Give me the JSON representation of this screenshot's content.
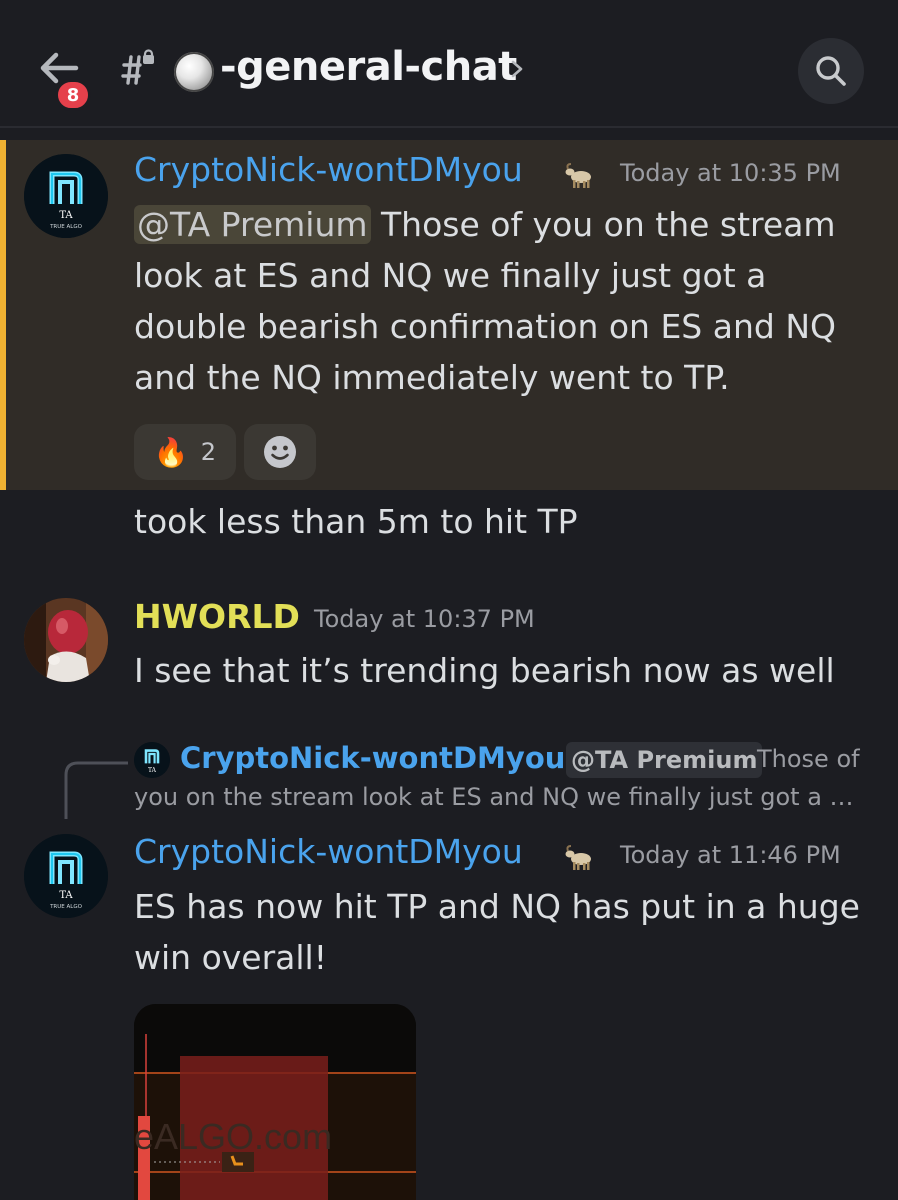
{
  "header": {
    "unread_badge": "8",
    "channel_name": "-general-chat",
    "back_icon": "arrow-left-icon",
    "hash_icon": "hash-icon",
    "search_icon": "search-icon"
  },
  "messages": [
    {
      "username": "CryptoNick-wontDMyou",
      "role_icon": "goat-icon",
      "timestamp": "Today at 10:35 PM",
      "mention": "@TA Premium",
      "lines_after_mention": " Those of you on the stream",
      "lines": [
        "look at ES and NQ we finally just got a",
        "double bearish confirmation on ES and NQ",
        "and the NQ immediately went to TP."
      ],
      "reactions": [
        {
          "emoji": "🔥",
          "count": "2"
        }
      ],
      "add_reaction_icon": "smiley-icon"
    },
    {
      "text": "took less than 5m to hit TP"
    },
    {
      "username": "HWORLD",
      "timestamp": "Today at 10:37 PM",
      "text": "I see that it’s trending bearish now as well"
    },
    {
      "reply": {
        "username": "CryptoNick-wontDMyou",
        "mention": "@TA Premium",
        "text_line1": "Those of",
        "text_line2": "you on the stream look at ES and NQ we finally just got a …"
      },
      "username": "CryptoNick-wontDMyou",
      "role_icon": "goat-icon",
      "timestamp": "Today at 11:46 PM",
      "lines": [
        "ES has now hit TP and NQ has put in a huge",
        "win overall!"
      ],
      "attachment_watermark": "eALGO.com"
    }
  ],
  "colors": {
    "background": "#1c1d22",
    "highlight": "#302c27",
    "highlight_bar": "#f0b232",
    "username_blue": "#4aa3ed",
    "username_yellow": "#e2df57",
    "badge_red": "#e5404b"
  }
}
